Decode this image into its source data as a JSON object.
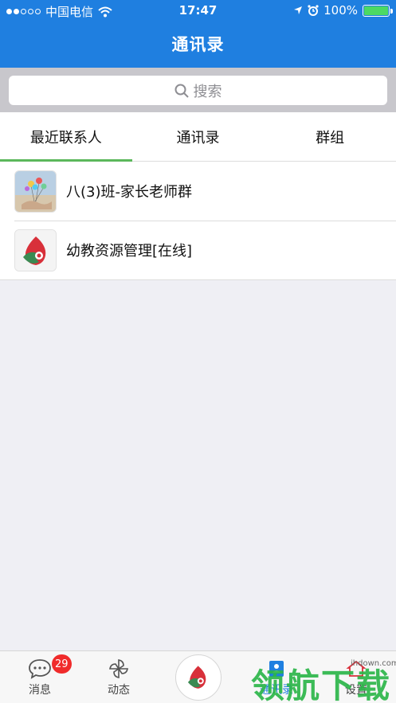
{
  "status": {
    "carrier": "中国电信",
    "time": "17:47",
    "battery": "100%",
    "battery_level": 1.0,
    "signal_bars_filled": 2
  },
  "header": {
    "title": "通讯录"
  },
  "search": {
    "placeholder": "搜索"
  },
  "tabs": [
    {
      "label": "最近联系人",
      "active": true
    },
    {
      "label": "通讯录",
      "active": false
    },
    {
      "label": "群组",
      "active": false
    }
  ],
  "contacts": [
    {
      "name": "八(3)班-家长老师群",
      "avatar": "balloons-photo"
    },
    {
      "name": "幼教资源管理[在线]",
      "avatar": "app-logo"
    }
  ],
  "tabbar": {
    "items": [
      {
        "label": "消息",
        "icon": "chat-bubble-icon",
        "badge": "29"
      },
      {
        "label": "动态",
        "icon": "pinwheel-icon"
      },
      {
        "label": "",
        "icon": "app-logo-icon"
      },
      {
        "label": "通讯录",
        "icon": "contacts-icon",
        "active": true
      },
      {
        "label": "设置",
        "icon": "settings-icon"
      }
    ]
  },
  "watermark": {
    "text": "领航下载",
    "url": "ihdown.com"
  },
  "colors": {
    "header": "#1f7fe0",
    "tab_indicator": "#5cb85c",
    "badge": "#f02b2b",
    "logo_red": "#d8303a",
    "logo_green": "#3a8a52"
  }
}
